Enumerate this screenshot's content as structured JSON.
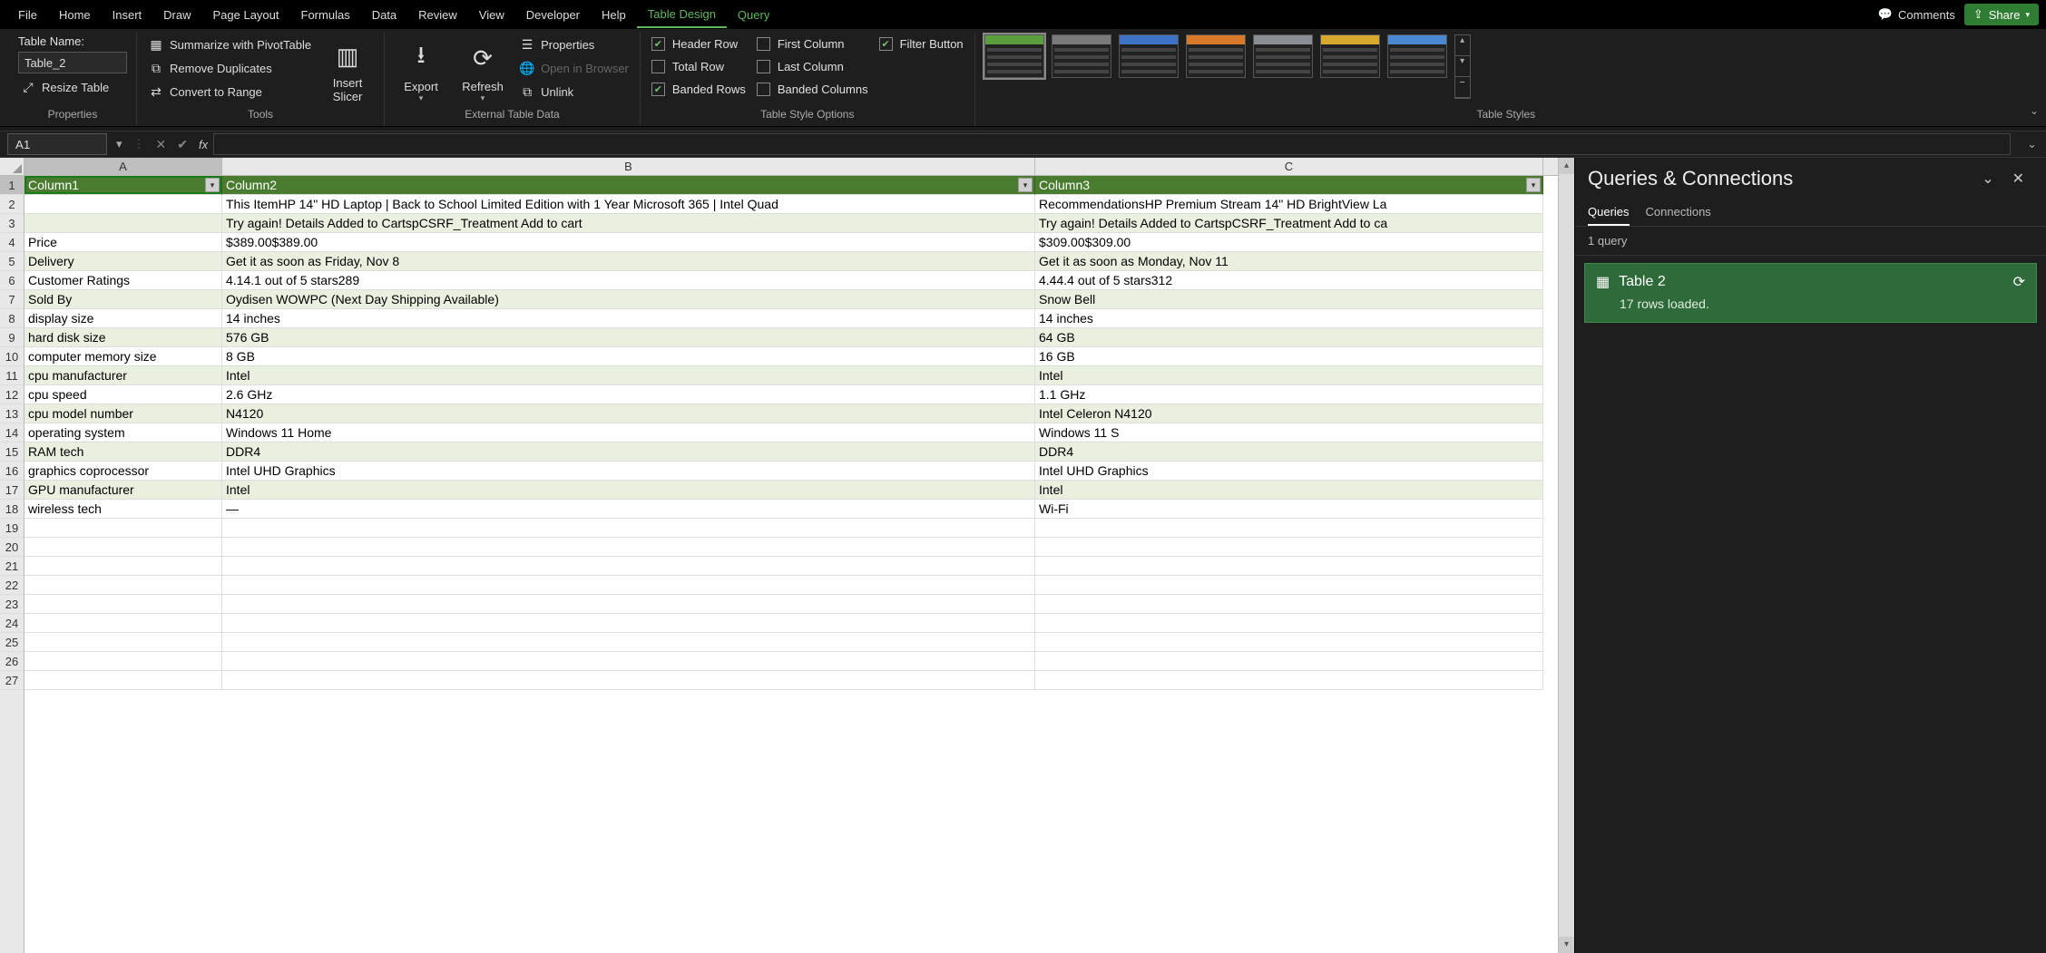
{
  "menubar": {
    "items": [
      "File",
      "Home",
      "Insert",
      "Draw",
      "Page Layout",
      "Formulas",
      "Data",
      "Review",
      "View",
      "Developer",
      "Help",
      "Table Design",
      "Query"
    ],
    "active": "Table Design",
    "comments": "Comments",
    "share": "Share"
  },
  "ribbon": {
    "properties": {
      "label": "Properties",
      "table_name_label": "Table Name:",
      "table_name_value": "Table_2",
      "resize": "Resize Table"
    },
    "tools": {
      "label": "Tools",
      "pivot": "Summarize with PivotTable",
      "dup": "Remove Duplicates",
      "convert": "Convert to Range",
      "slicer": "Insert Slicer"
    },
    "external": {
      "label": "External Table Data",
      "export": "Export",
      "refresh": "Refresh",
      "props": "Properties",
      "browser": "Open in Browser",
      "unlink": "Unlink"
    },
    "styleopts": {
      "label": "Table Style Options",
      "header_row": "Header Row",
      "total_row": "Total Row",
      "banded_rows": "Banded Rows",
      "first_col": "First Column",
      "last_col": "Last Column",
      "banded_cols": "Banded Columns",
      "filter": "Filter Button"
    },
    "styles": {
      "label": "Table Styles",
      "colors": [
        "#5a9e3d",
        "#7a7a7a",
        "#3d74c7",
        "#d77a2a",
        "#8a8f96",
        "#d9a82e",
        "#4a88d1"
      ]
    }
  },
  "namebox": "A1",
  "formula": "",
  "sheet": {
    "col_widths": {
      "A": 218,
      "B": 896,
      "C": 560
    },
    "columns": [
      "A",
      "B",
      "C"
    ],
    "row_count": 27,
    "header": [
      "Column1",
      "Column2",
      "Column3"
    ],
    "rows": [
      [
        "",
        "This ItemHP 14\" HD Laptop | Back to School Limited Edition with 1 Year Microsoft 365 | Intel Quad",
        "RecommendationsHP Premium Stream 14\" HD BrightView La"
      ],
      [
        "",
        "Try again! Details Added to CartspCSRF_Treatment Add to cart",
        "Try again! Details Added to CartspCSRF_Treatment Add to ca"
      ],
      [
        "Price",
        "$389.00$389.00",
        "$309.00$309.00"
      ],
      [
        "Delivery",
        "Get it as soon as Friday, Nov 8",
        "Get it as soon as Monday, Nov 11"
      ],
      [
        "Customer Ratings",
        "4.14.1 out of 5 stars289",
        "4.44.4 out of 5 stars312"
      ],
      [
        "Sold By",
        "Oydisen WOWPC (Next Day Shipping Available)",
        "Snow Bell"
      ],
      [
        "display size",
        "14 inches",
        "14 inches"
      ],
      [
        "hard disk size",
        "576 GB",
        "64 GB"
      ],
      [
        "computer memory size",
        "8 GB",
        "16 GB"
      ],
      [
        "cpu manufacturer",
        "Intel",
        "Intel"
      ],
      [
        "cpu speed",
        "2.6 GHz",
        "1.1 GHz"
      ],
      [
        "cpu model number",
        "N4120",
        "Intel Celeron N4120"
      ],
      [
        "operating system",
        "Windows 11 Home",
        "Windows 11 S"
      ],
      [
        "RAM tech",
        "DDR4",
        "DDR4"
      ],
      [
        "graphics coprocessor",
        "Intel UHD Graphics",
        "Intel UHD Graphics"
      ],
      [
        "GPU manufacturer",
        "Intel",
        "Intel"
      ],
      [
        "wireless tech",
        "—",
        "Wi-Fi"
      ]
    ]
  },
  "queries": {
    "title": "Queries & Connections",
    "tab_queries": "Queries",
    "tab_connections": "Connections",
    "count": "1 query",
    "item_name": "Table 2",
    "item_status": "17 rows loaded."
  }
}
